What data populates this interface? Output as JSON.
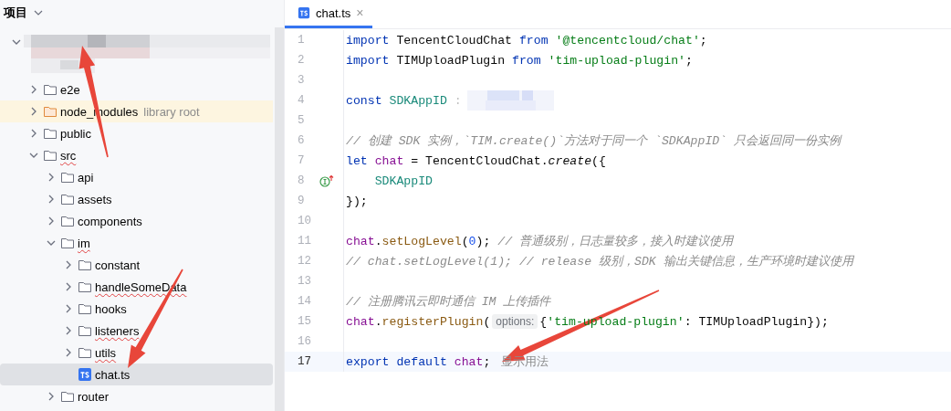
{
  "project_panel": {
    "title": "项目",
    "tree": [
      {
        "kind": "redacted",
        "expanded": true,
        "children": [
          {
            "kind": "folder",
            "label": "e2e",
            "expanded": false,
            "selected": false,
            "misspelled": false
          },
          {
            "kind": "library",
            "label": "node_modules",
            "hint": "library root",
            "expanded": false,
            "selected": false,
            "misspelled": false
          },
          {
            "kind": "folder",
            "label": "public",
            "expanded": false,
            "selected": false,
            "misspelled": false
          },
          {
            "kind": "folder",
            "label": "src",
            "expanded": true,
            "selected": false,
            "misspelled": true,
            "children": [
              {
                "kind": "folder",
                "label": "api",
                "expanded": false,
                "selected": false,
                "misspelled": false
              },
              {
                "kind": "folder",
                "label": "assets",
                "expanded": false,
                "selected": false,
                "misspelled": false
              },
              {
                "kind": "folder",
                "label": "components",
                "expanded": false,
                "selected": false,
                "misspelled": false
              },
              {
                "kind": "folder",
                "label": "im",
                "expanded": true,
                "selected": false,
                "misspelled": true,
                "children": [
                  {
                    "kind": "folder",
                    "label": "constant",
                    "expanded": false,
                    "selected": false,
                    "misspelled": false
                  },
                  {
                    "kind": "folder",
                    "label": "handleSomeData",
                    "expanded": false,
                    "selected": false,
                    "misspelled": true
                  },
                  {
                    "kind": "folder",
                    "label": "hooks",
                    "expanded": false,
                    "selected": false,
                    "misspelled": false
                  },
                  {
                    "kind": "folder",
                    "label": "listeners",
                    "expanded": false,
                    "selected": false,
                    "misspelled": true
                  },
                  {
                    "kind": "folder",
                    "label": "utils",
                    "expanded": false,
                    "selected": false,
                    "misspelled": true
                  },
                  {
                    "kind": "file",
                    "label": "chat.ts",
                    "selected": true,
                    "misspelled": false
                  }
                ]
              },
              {
                "kind": "folder",
                "label": "router",
                "expanded": false,
                "selected": false,
                "misspelled": false
              }
            ]
          }
        ]
      }
    ]
  },
  "editor": {
    "tabs": [
      {
        "label": "chat.ts",
        "close": "×",
        "selected": true
      }
    ],
    "lines": [
      {
        "number": "1",
        "current": false,
        "tokens": [
          {
            "kind": "kw",
            "t": "import "
          },
          {
            "kind": "plain",
            "t": "TencentCloudChat "
          },
          {
            "kind": "kw",
            "t": "from "
          },
          {
            "kind": "str",
            "t": "'@tencentcloud/chat'"
          },
          {
            "kind": "plain",
            "t": ";"
          }
        ]
      },
      {
        "number": "2",
        "current": false,
        "tokens": [
          {
            "kind": "kw",
            "t": "import "
          },
          {
            "kind": "plain",
            "t": "TIMUploadPlugin "
          },
          {
            "kind": "kw",
            "t": "from "
          },
          {
            "kind": "str",
            "t": "'tim-upload-plugin'"
          },
          {
            "kind": "plain",
            "t": ";"
          }
        ]
      },
      {
        "number": "3",
        "current": false
      },
      {
        "number": "4",
        "current": false,
        "tokens": [
          {
            "kind": "kw",
            "t": "const "
          },
          {
            "kind": "const",
            "t": "SDKAppID"
          },
          {
            "kind": "faint",
            "t": " :"
          },
          {
            "kind": "blur"
          }
        ]
      },
      {
        "number": "5",
        "current": false
      },
      {
        "number": "6",
        "current": false,
        "tokens": [
          {
            "kind": "comment",
            "t": "// 创建 SDK 实例，`TIM.create()`方法对于同一个 `SDKAppID` 只会返回同一份实例"
          }
        ]
      },
      {
        "number": "7",
        "current": false,
        "tokens": [
          {
            "kind": "kw",
            "t": "let "
          },
          {
            "kind": "var",
            "t": "chat"
          },
          {
            "kind": "plain",
            "t": " = TencentCloudChat."
          },
          {
            "kind": "fn",
            "t": "create"
          },
          {
            "kind": "plain",
            "t": "({"
          }
        ]
      },
      {
        "number": "8",
        "current": false,
        "gutter_icon": true,
        "tokens": [
          {
            "kind": "const",
            "t": "    SDKAppID"
          }
        ]
      },
      {
        "number": "9",
        "current": false,
        "tokens": [
          {
            "kind": "plain",
            "t": "});"
          }
        ]
      },
      {
        "number": "10",
        "current": false
      },
      {
        "number": "11",
        "current": false,
        "tokens": [
          {
            "kind": "var",
            "t": "chat"
          },
          {
            "kind": "plain",
            "t": "."
          },
          {
            "kind": "method",
            "t": "setLogLevel"
          },
          {
            "kind": "plain",
            "t": "("
          },
          {
            "kind": "num",
            "t": "0"
          },
          {
            "kind": "plain",
            "t": "); "
          },
          {
            "kind": "comment",
            "t": "// 普通级别，日志量较多，接入时建议使用"
          }
        ]
      },
      {
        "number": "12",
        "current": false,
        "tokens": [
          {
            "kind": "comment",
            "t": "// chat.setLogLevel(1); // release 级别，SDK 输出关键信息，生产环境时建议使用"
          }
        ]
      },
      {
        "number": "13",
        "current": false
      },
      {
        "number": "14",
        "current": false,
        "tokens": [
          {
            "kind": "comment",
            "t": "// 注册腾讯云即时通信 IM 上传插件"
          }
        ]
      },
      {
        "number": "15",
        "current": false,
        "tokens": [
          {
            "kind": "var",
            "t": "chat"
          },
          {
            "kind": "plain",
            "t": "."
          },
          {
            "kind": "method",
            "t": "registerPlugin"
          },
          {
            "kind": "plain",
            "t": "("
          },
          {
            "kind": "hint",
            "t": "options:"
          },
          {
            "kind": "plain",
            "t": "{"
          },
          {
            "kind": "str",
            "t": "'tim-upload-plugin'"
          },
          {
            "kind": "plain",
            "t": ": TIMUploadPlugin});"
          }
        ]
      },
      {
        "number": "16",
        "current": false
      },
      {
        "number": "17",
        "current": true,
        "tokens": [
          {
            "kind": "kw",
            "t": "export default "
          },
          {
            "kind": "var",
            "t": "chat"
          },
          {
            "kind": "plain",
            "t": ";"
          },
          {
            "kind": "usage",
            "t": "显示用法"
          }
        ]
      }
    ]
  },
  "annotation_arrows": [
    {
      "color": "#e8463a"
    },
    {
      "color": "#e8463a"
    },
    {
      "color": "#e8463a"
    }
  ]
}
